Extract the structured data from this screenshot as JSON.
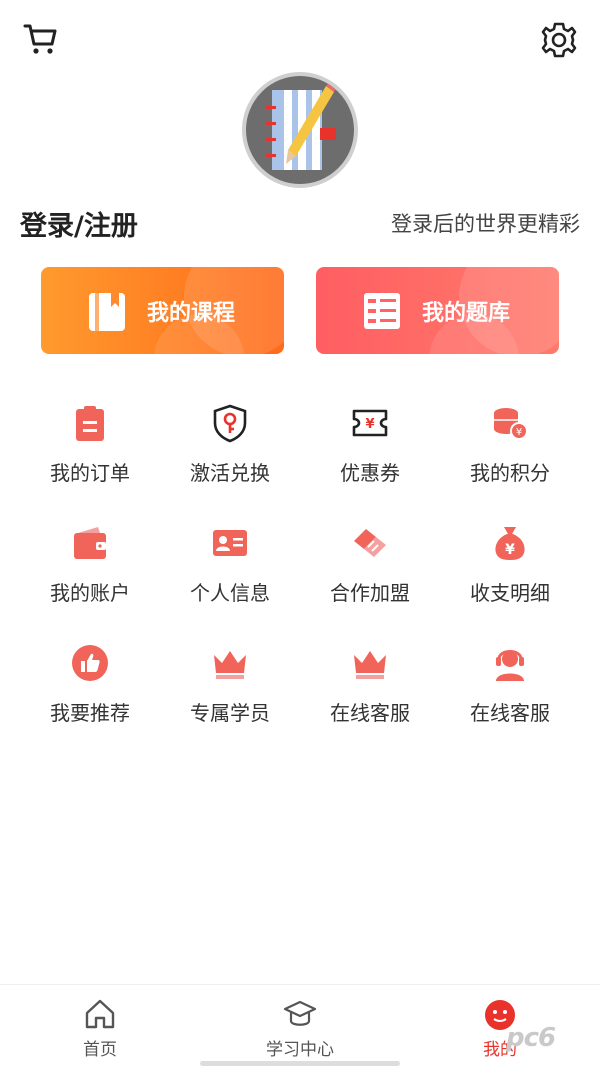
{
  "header": {
    "cart_icon": "cart-icon",
    "settings_icon": "gear-icon"
  },
  "profile": {
    "login_label": "登录/注册",
    "login_hint": "登录后的世界更精彩"
  },
  "quick_buttons": [
    {
      "label": "我的课程",
      "icon": "book-icon",
      "color": "#ff7a22"
    },
    {
      "label": "我的题库",
      "icon": "question-bank-icon",
      "color": "#ff6464"
    }
  ],
  "menu": [
    {
      "label": "我的订单",
      "icon": "clipboard-icon"
    },
    {
      "label": "激活兑换",
      "icon": "shield-key-icon"
    },
    {
      "label": "优惠券",
      "icon": "coupon-icon"
    },
    {
      "label": "我的积分",
      "icon": "coins-icon"
    },
    {
      "label": "我的账户",
      "icon": "wallet-icon"
    },
    {
      "label": "个人信息",
      "icon": "id-card-icon"
    },
    {
      "label": "合作加盟",
      "icon": "handshake-icon"
    },
    {
      "label": "收支明细",
      "icon": "money-bag-icon"
    },
    {
      "label": "我要推荐",
      "icon": "thumbs-up-icon"
    },
    {
      "label": "专属学员",
      "icon": "crown-icon"
    },
    {
      "label": "在线客服",
      "icon": "crown-icon"
    },
    {
      "label": "在线客服",
      "icon": "headset-icon"
    }
  ],
  "tabbar": {
    "items": [
      {
        "label": "首页",
        "icon": "home-icon"
      },
      {
        "label": "学习中心",
        "icon": "graduation-cap-icon"
      },
      {
        "label": "我的",
        "icon": "mascot-icon"
      }
    ],
    "active_color": "#e8322b"
  },
  "watermark": "pc6"
}
